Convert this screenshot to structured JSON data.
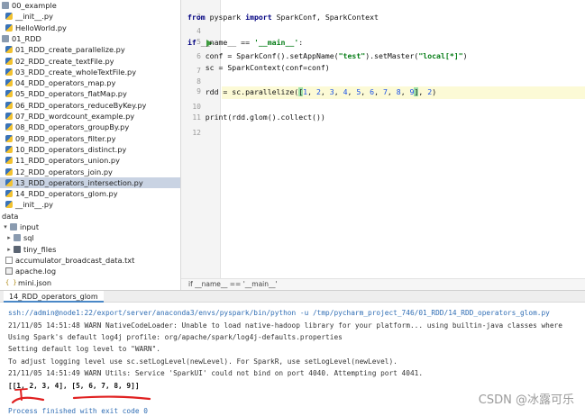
{
  "project_tree": {
    "items": [
      {
        "label": "00_example",
        "icon": "folder",
        "indent": 0
      },
      {
        "label": "__init__.py",
        "icon": "python-file",
        "indent": 1
      },
      {
        "label": "HelloWorld.py",
        "icon": "python-file",
        "indent": 1
      },
      {
        "label": "01_RDD",
        "icon": "folder",
        "indent": 0
      },
      {
        "label": "01_RDD_create_parallelize.py",
        "icon": "python-file",
        "indent": 1
      },
      {
        "label": "02_RDD_create_textFile.py",
        "icon": "python-file",
        "indent": 1
      },
      {
        "label": "03_RDD_create_wholeTextFile.py",
        "icon": "python-file",
        "indent": 1
      },
      {
        "label": "04_RDD_operators_map.py",
        "icon": "python-file",
        "indent": 1
      },
      {
        "label": "05_RDD_operators_flatMap.py",
        "icon": "python-file",
        "indent": 1
      },
      {
        "label": "06_RDD_operators_reduceByKey.py",
        "icon": "python-file",
        "indent": 1
      },
      {
        "label": "07_RDD_wordcount_example.py",
        "icon": "python-file",
        "indent": 1
      },
      {
        "label": "08_RDD_operators_groupBy.py",
        "icon": "python-file",
        "indent": 1
      },
      {
        "label": "09_RDD_operators_filter.py",
        "icon": "python-file",
        "indent": 1
      },
      {
        "label": "10_RDD_operators_distinct.py",
        "icon": "python-file",
        "indent": 1
      },
      {
        "label": "11_RDD_operators_union.py",
        "icon": "python-file",
        "indent": 1
      },
      {
        "label": "12_RDD_operators_join.py",
        "icon": "python-file",
        "indent": 1
      },
      {
        "label": "13_RDD_operators_intersection.py",
        "icon": "python-file",
        "indent": 1,
        "selected": true
      },
      {
        "label": "14_RDD_operators_glom.py",
        "icon": "python-file",
        "indent": 1
      },
      {
        "label": "__init__.py",
        "icon": "python-file",
        "indent": 1
      },
      {
        "label": "data",
        "icon": "none",
        "indent": 0
      },
      {
        "label": "input",
        "icon": "folder",
        "indent": 0,
        "arrow": "down"
      },
      {
        "label": "sql",
        "icon": "folder",
        "indent": 1,
        "arrow": "right"
      },
      {
        "label": "tiny_files",
        "icon": "folder-dark",
        "indent": 1,
        "arrow": "right"
      },
      {
        "label": "accumulator_broadcast_data.txt",
        "icon": "text-file",
        "indent": 1
      },
      {
        "label": "apache.log",
        "icon": "log-file",
        "indent": 1
      },
      {
        "label": "mini.json",
        "icon": "json-file",
        "indent": 1
      }
    ]
  },
  "editor": {
    "line_numbers": [
      "3",
      "4",
      "5",
      "6",
      "7",
      "8",
      "9",
      "10",
      "11",
      "12"
    ],
    "lines": {
      "l3_kw_from": "from",
      "l3_mod": " pyspark ",
      "l3_kw_import": "import",
      "l3_rest": " SparkConf, SparkContext",
      "l5_kw_if": "if",
      "l5_a": " __name__ == ",
      "l5_str": "'__main__'",
      "l5_b": ":",
      "l6_a": "    conf = SparkConf().setAppName(",
      "l6_str1": "\"test\"",
      "l6_b": ").setMaster(",
      "l6_str2": "\"local[*]\"",
      "l6_c": ")",
      "l7": "    sc = SparkContext(conf=conf)",
      "l9_a": "    rdd = sc.parallelize(",
      "l9_hl": "[",
      "l9_n1": "1",
      "l9_s1": ", ",
      "l9_n2": "2",
      "l9_s2": ", ",
      "l9_n3": "3",
      "l9_s3": ", ",
      "l9_n4": "4",
      "l9_s4": ", ",
      "l9_n5": "5",
      "l9_s5": ", ",
      "l9_n6": "6",
      "l9_s6": ", ",
      "l9_n7": "7",
      "l9_s7": ", ",
      "l9_n8": "8",
      "l9_s8": ", ",
      "l9_n9": "9",
      "l9_hl2": "]",
      "l9_s9": ", ",
      "l9_n10": "2",
      "l9_end": ")",
      "l11": "    print(rdd.glom().collect())"
    },
    "breadcrumb": "if __name__ == '__main__'"
  },
  "run_panel": {
    "tab_label": "14_RDD_operators_glom",
    "console_lines": [
      "ssh://admin@node1:22/export/server/anaconda3/envs/pyspark/bin/python -u /tmp/pycharm_project_746/01_RDD/14_RDD_operators_glom.py",
      "21/11/05 14:51:48 WARN NativeCodeLoader: Unable to load native-hadoop library for your platform... using builtin-java classes where",
      "Using Spark's default log4j profile: org/apache/spark/log4j-defaults.properties",
      "Setting default log level to \"WARN\".",
      "To adjust logging level use sc.setLogLevel(newLevel). For SparkR, use setLogLevel(newLevel).",
      "21/11/05 14:51:49 WARN Utils: Service 'SparkUI' could not bind on port 4040. Attempting port 4041.",
      "[[1, 2, 3, 4], [5, 6, 7, 8, 9]]",
      "Process finished with exit code 0"
    ]
  },
  "watermark": "CSDN @冰露可乐",
  "colors": {
    "keyword": "#000080",
    "string": "#067d17",
    "number": "#1750eb",
    "selection": "#c9d3e3",
    "bracket_highlight": "#9ee0a9",
    "annotation_red": "#e02020"
  }
}
